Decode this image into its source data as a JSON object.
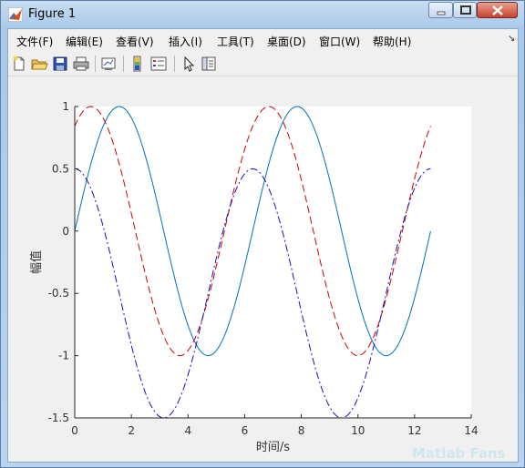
{
  "window": {
    "title": "Figure 1"
  },
  "menu": [
    {
      "label": "文件(F)"
    },
    {
      "label": "编辑(E)"
    },
    {
      "label": "查看(V)"
    },
    {
      "label": "插入(I)"
    },
    {
      "label": "工具(T)"
    },
    {
      "label": "桌面(D)"
    },
    {
      "label": "窗口(W)"
    },
    {
      "label": "帮助(H)"
    }
  ],
  "toolbar": [
    "new-figure-icon",
    "open-folder-icon",
    "save-icon",
    "print-icon",
    "link-plot-icon",
    "colorbar-icon",
    "legend-icon",
    "pointer-icon",
    "property-editor-icon"
  ],
  "colors": {
    "line1": "#0072bd",
    "line2": "#d00000",
    "line3": "#1010c8"
  },
  "chart_data": {
    "type": "line",
    "xlabel": "时间/s",
    "ylabel": "幅值",
    "xlim": [
      0,
      14
    ],
    "ylim": [
      -1.5,
      1
    ],
    "xticks": [
      0,
      2,
      4,
      6,
      8,
      10,
      12,
      14
    ],
    "yticks": [
      1,
      0.5,
      0,
      -0.5,
      -1,
      -1.5
    ],
    "grid": false,
    "x_range": [
      0,
      12.566
    ],
    "series": [
      {
        "style": "solid",
        "color": "#0072bd",
        "formula": "sin(x)",
        "peak_x": 1.57,
        "trough_x": 4.71
      },
      {
        "style": "dashed",
        "color": "#d00000",
        "formula": "sin(x+1)",
        "peak_x": 0.57,
        "trough_x": 3.71
      },
      {
        "style": "dash-dot",
        "color": "#1010c8",
        "formula": "sin(x+1)-0.5 ... peaks 0.5, troughs -1.5",
        "peak_x": 0.0,
        "trough_x": 3.14
      }
    ]
  },
  "watermark": "Matlab Fans"
}
